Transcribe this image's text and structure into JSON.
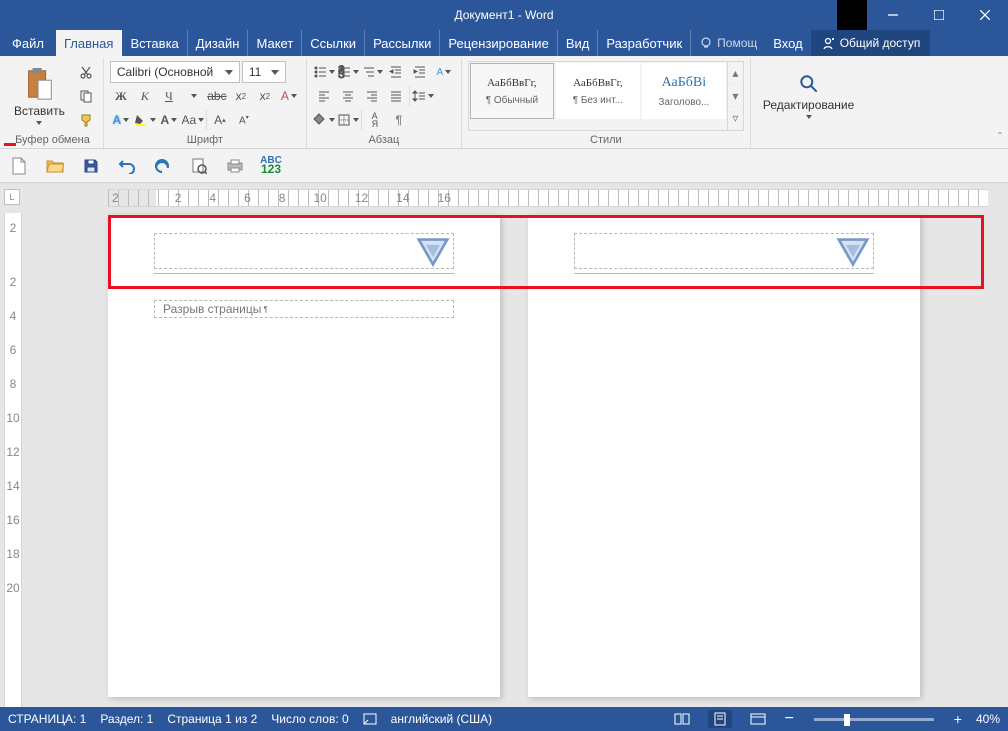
{
  "title": "Документ1 - Word",
  "tabs": {
    "file": "Файл",
    "home": "Главная",
    "insert": "Вставка",
    "design": "Дизайн",
    "layout": "Макет",
    "references": "Ссылки",
    "mailings": "Рассылки",
    "review": "Рецензирование",
    "view": "Вид",
    "developer": "Разработчик"
  },
  "help_label": "Помощ",
  "signin": "Вход",
  "share": "Общий доступ",
  "clipboard": {
    "paste": "Вставить",
    "group": "Буфер обмена"
  },
  "font": {
    "name": "Calibri (Основной",
    "size": "11",
    "group": "Шрифт"
  },
  "paragraph": {
    "group": "Абзац"
  },
  "styles": {
    "group": "Стили",
    "items": [
      {
        "preview": "АаБбВвГг,",
        "name": "¶ Обычный"
      },
      {
        "preview": "АаБбВвГг,",
        "name": "¶ Без инт..."
      },
      {
        "preview": "АаБбВі",
        "name": "Заголово..."
      }
    ]
  },
  "editing": {
    "label": "Редактирование"
  },
  "ruler_h": [
    "2",
    "",
    "2",
    "4",
    "6",
    "8",
    "10",
    "12",
    "14",
    "16"
  ],
  "ruler_v": [
    "2",
    "",
    "2",
    "4",
    "6",
    "8",
    "10",
    "12",
    "14",
    "16",
    "18",
    "20"
  ],
  "page_break": "Разрыв страницы",
  "status": {
    "page": "СТРАНИЦА: 1",
    "section": "Раздел: 1",
    "pages": "Страница 1 из 2",
    "words": "Число слов: 0",
    "lang": "английский (США)",
    "zoom": "40%"
  }
}
